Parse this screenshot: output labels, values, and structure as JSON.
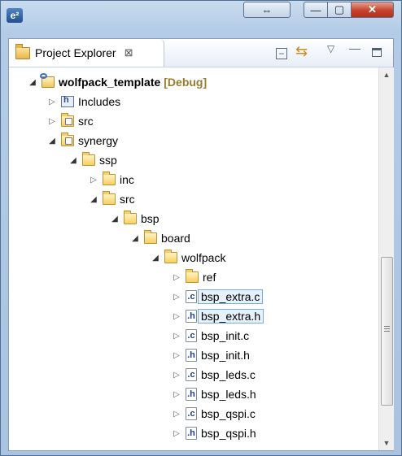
{
  "window": {
    "app_icon": "e²",
    "resize_glyph": "⇔",
    "minimize_glyph": "—",
    "maximize_glyph": "▢",
    "close_glyph": "✕"
  },
  "view": {
    "tab_title": "Project Explorer",
    "tab_close_glyph": "⊠",
    "collapse_glyph": "−",
    "link_glyph": "⇆",
    "view_menu_glyph": "▽",
    "minimize_glyph": "—"
  },
  "tree": {
    "project": {
      "label": "wolfpack_template",
      "config": "[Debug]"
    },
    "includes": "Includes",
    "src": "src",
    "synergy": "synergy",
    "ssp": "ssp",
    "inc": "inc",
    "ssp_src": "src",
    "bsp": "bsp",
    "board": "board",
    "wolfpack": "wolfpack",
    "ref": "ref",
    "files": [
      {
        "ext": "c",
        "name": "bsp_extra.c",
        "selected": true
      },
      {
        "ext": "h",
        "name": "bsp_extra.h",
        "selected": true
      },
      {
        "ext": "c",
        "name": "bsp_init.c",
        "selected": false
      },
      {
        "ext": "h",
        "name": "bsp_init.h",
        "selected": false
      },
      {
        "ext": "c",
        "name": "bsp_leds.c",
        "selected": false
      },
      {
        "ext": "h",
        "name": "bsp_leds.h",
        "selected": false
      },
      {
        "ext": "c",
        "name": "bsp_qspi.c",
        "selected": false
      },
      {
        "ext": "h",
        "name": "bsp_qspi.h",
        "selected": false
      }
    ]
  },
  "colors": {
    "selection_bg": "#e5f1fb",
    "selection_border": "#7aaee0",
    "debug_label": "#9a7a2b",
    "folder": "#f5cf62"
  },
  "icons": {
    "expanded": "triangle-down-icon",
    "collapsed": "triangle-right-icon",
    "folder": "folder-icon",
    "source_folder": "source-folder-icon",
    "project": "project-icon",
    "c_file": "c-file-icon",
    "h_file": "h-file-icon"
  }
}
